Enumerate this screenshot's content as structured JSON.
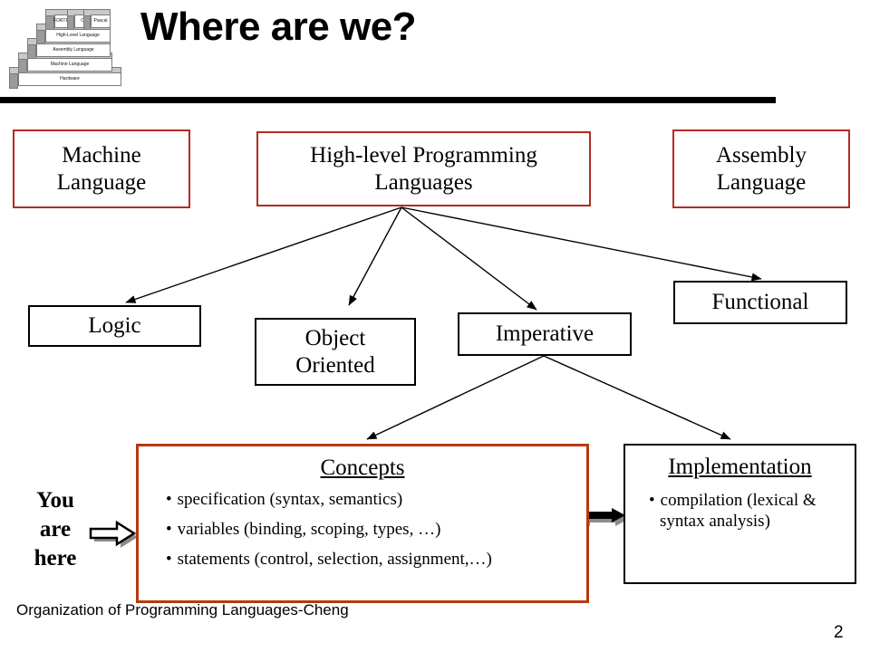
{
  "slide": {
    "title": "Where are we?",
    "footer": "Organization of Programming Languages-Cheng",
    "page_number": "2",
    "accent_red": "#b42b22",
    "accent_orange": "#b8380e"
  },
  "logo": {
    "name": "language-abstraction-pyramid",
    "layers": [
      {
        "label": "FORTRAN"
      },
      {
        "label": "C"
      },
      {
        "label": "Pascal"
      },
      {
        "label": "High-Level Language"
      },
      {
        "label": "Assembly Language"
      },
      {
        "label": "Machine Language"
      },
      {
        "label": "Hardware"
      }
    ]
  },
  "nodes": {
    "machine_language": "Machine\nLanguage",
    "machine_language_l1": "Machine",
    "machine_language_l2": "Language",
    "high_level": "High-level Programming Languages",
    "high_level_l1": "High-level Programming",
    "high_level_l2": "Languages",
    "assembly_l1": "Assembly",
    "assembly_l2": "Language",
    "logic": "Logic",
    "object_oriented_l1": "Object",
    "object_oriented_l2": "Oriented",
    "imperative": "Imperative",
    "functional": "Functional"
  },
  "concepts": {
    "title": "Concepts",
    "items": [
      "specification (syntax, semantics)",
      "variables (binding, scoping, types, …)",
      "statements (control, selection, assignment,…)"
    ]
  },
  "implementation": {
    "title": "Implementation",
    "items": [
      "compilation (lexical & syntax analysis)"
    ]
  },
  "pointer": {
    "line1": "You",
    "line2": "are",
    "line3": "here"
  }
}
